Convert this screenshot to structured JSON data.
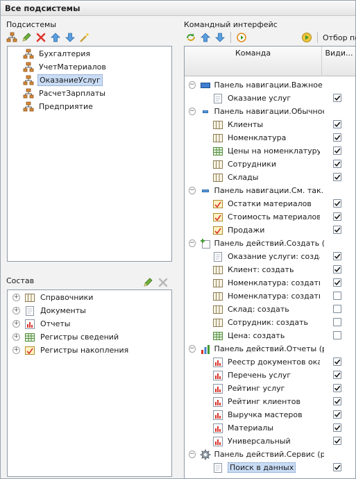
{
  "window": {
    "title": "Все подсистемы"
  },
  "subsystems": {
    "label": "Подсистемы",
    "items": [
      {
        "label": "Бухгалтерия",
        "selected": false
      },
      {
        "label": "УчетМатериалов",
        "selected": false
      },
      {
        "label": "ОказаниеУслуг",
        "selected": true
      },
      {
        "label": "РасчетЗарплаты",
        "selected": false
      },
      {
        "label": "Предприятие",
        "selected": false
      }
    ]
  },
  "composition": {
    "label": "Состав",
    "items": [
      {
        "label": "Справочники",
        "icon": "catalog-icon"
      },
      {
        "label": "Документы",
        "icon": "document-icon"
      },
      {
        "label": "Отчеты",
        "icon": "report-icon"
      },
      {
        "label": "Регистры сведений",
        "icon": "info-register-icon"
      },
      {
        "label": "Регистры накопления",
        "icon": "accumulation-register-icon"
      }
    ]
  },
  "command_interface": {
    "label": "Командный интерфейс",
    "filter_label": "Отбор по р",
    "columns": {
      "command": "Команда",
      "visible": "Види..."
    },
    "groups": [
      {
        "label": "Панель навигации.Важное (...",
        "icon": "nav-important-icon",
        "rows": [
          {
            "label": "Оказание услуг",
            "icon": "document-icon",
            "checked": true
          }
        ]
      },
      {
        "label": "Панель навигации.Обычное...",
        "icon": "nav-normal-icon",
        "rows": [
          {
            "label": "Клиенты",
            "icon": "catalog-icon",
            "checked": true
          },
          {
            "label": "Номенклатура",
            "icon": "catalog-icon",
            "checked": true
          },
          {
            "label": "Цены на номенклатуру",
            "icon": "info-register-icon",
            "checked": true
          },
          {
            "label": "Сотрудники",
            "icon": "catalog-icon",
            "checked": true
          },
          {
            "label": "Склады",
            "icon": "catalog-icon",
            "checked": true
          }
        ]
      },
      {
        "label": "Панель навигации.См. так...",
        "icon": "nav-see-also-icon",
        "rows": [
          {
            "label": "Остатки материалов",
            "icon": "accumulation-register-icon",
            "checked": true
          },
          {
            "label": "Стоимость материалов",
            "icon": "accumulation-register-icon",
            "checked": true
          },
          {
            "label": "Продажи",
            "icon": "accumulation-register-icon",
            "checked": true
          }
        ]
      },
      {
        "label": "Панель действий.Создать (...",
        "icon": "create-icon",
        "rows": [
          {
            "label": "Оказание услуги: созда...",
            "icon": "document-icon",
            "checked": true
          },
          {
            "label": "Клиент: создать",
            "icon": "catalog-icon",
            "checked": true
          },
          {
            "label": "Номенклатура: создать",
            "icon": "catalog-icon",
            "checked": true
          },
          {
            "label": "Номенклатура: создать...",
            "icon": "catalog-icon",
            "checked": false
          },
          {
            "label": "Склад: создать",
            "icon": "catalog-icon",
            "checked": false
          },
          {
            "label": "Сотрудник: создать",
            "icon": "catalog-icon",
            "checked": false
          },
          {
            "label": "Цена: создать",
            "icon": "info-register-icon",
            "checked": false
          }
        ]
      },
      {
        "label": "Панель действий.Отчеты (р...",
        "icon": "reports-panel-icon",
        "rows": [
          {
            "label": "Реестр документов ока...",
            "icon": "report-icon",
            "checked": true
          },
          {
            "label": "Перечень услуг",
            "icon": "report-icon",
            "checked": true
          },
          {
            "label": "Рейтинг услуг",
            "icon": "report-icon",
            "checked": true
          },
          {
            "label": "Рейтинг клиентов",
            "icon": "report-icon",
            "checked": true
          },
          {
            "label": "Выручка мастеров",
            "icon": "report-icon",
            "checked": true
          },
          {
            "label": "Материалы",
            "icon": "report-icon",
            "checked": true
          },
          {
            "label": "Универсальный",
            "icon": "report-icon",
            "checked": true
          }
        ]
      },
      {
        "label": "Панель действий.Сервис (р...",
        "icon": "service-gear-icon",
        "rows": [
          {
            "label": "Поиск в данных",
            "icon": "document-icon",
            "checked": true,
            "selected": true
          }
        ]
      }
    ]
  },
  "colors": {
    "selection": "#c9dcf5",
    "border": "#8f9aa6",
    "check": "#1a1a1a"
  }
}
